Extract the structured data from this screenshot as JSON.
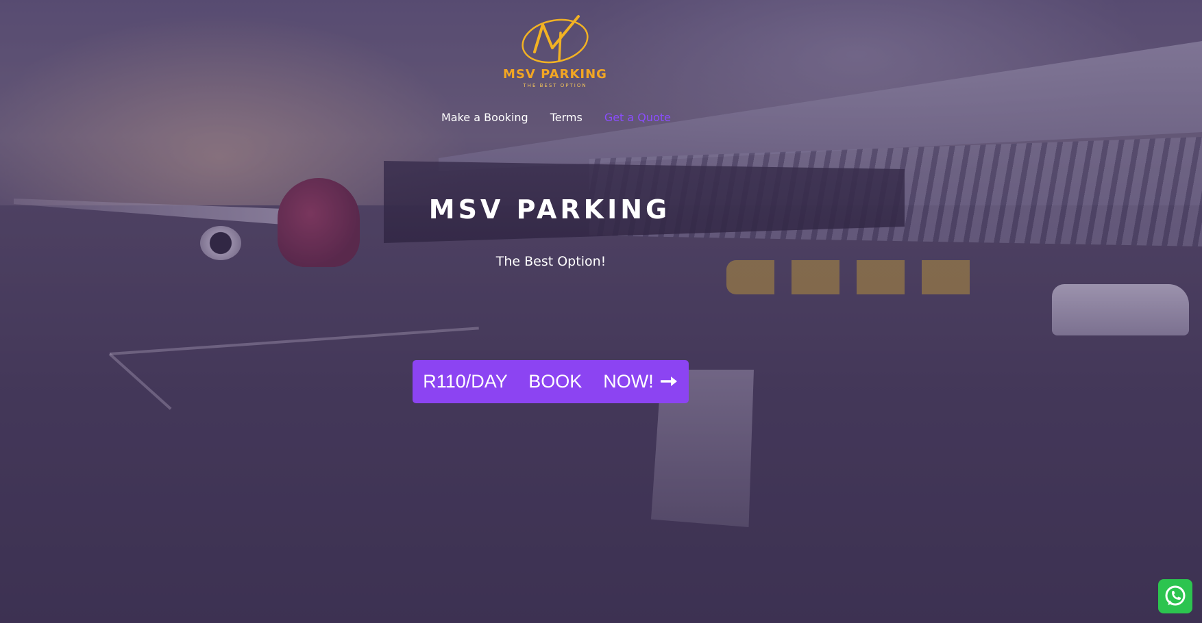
{
  "brand": {
    "logo_text": "MSV PARKING",
    "logo_tagline": "THE BEST OPTION",
    "logo_icon": "msv-monogram-logo",
    "accent_color": "#f2a623"
  },
  "nav": {
    "items": [
      {
        "label": "Make a Booking",
        "active": false
      },
      {
        "label": "Terms",
        "active": false
      },
      {
        "label": "Get a Quote",
        "active": true
      }
    ],
    "active_color": "#8b4dff"
  },
  "hero": {
    "title": "MSV PARKING",
    "subtitle": "The Best Option!",
    "cta_label": "R110/DAY  BOOK  NOW!",
    "cta_icon": "arrow-right-icon",
    "cta_color": "#8c44f2",
    "background": "airport-apron-photo"
  },
  "floating": {
    "whatsapp_icon": "whatsapp-icon",
    "whatsapp_color": "#2cc44f"
  }
}
